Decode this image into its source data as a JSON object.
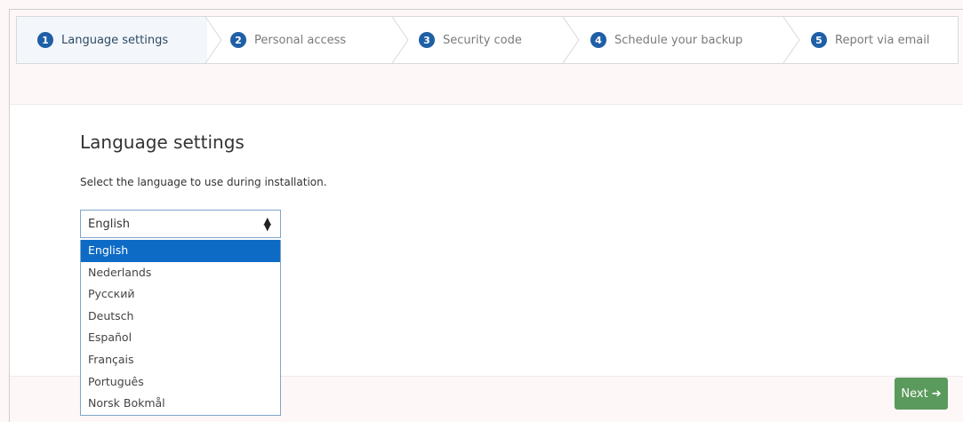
{
  "steps": [
    {
      "num": "1",
      "label": "Language settings"
    },
    {
      "num": "2",
      "label": "Personal access"
    },
    {
      "num": "3",
      "label": "Security code"
    },
    {
      "num": "4",
      "label": "Schedule your backup"
    },
    {
      "num": "5",
      "label": "Report via email"
    }
  ],
  "page": {
    "title": "Language settings",
    "description": "Select the language to use during installation."
  },
  "language_select": {
    "value": "English",
    "options": [
      "English",
      "Nederlands",
      "Русский",
      "Deutsch",
      "Español",
      "Français",
      "Português",
      "Norsk Bokmål"
    ],
    "selected_index": 0
  },
  "footer": {
    "next_label": "Next",
    "next_icon": "arrow-right-icon"
  },
  "colors": {
    "accent": "#1f5fa6",
    "selected_option": "#0e6bc5",
    "next_button": "#5a9a5c"
  }
}
